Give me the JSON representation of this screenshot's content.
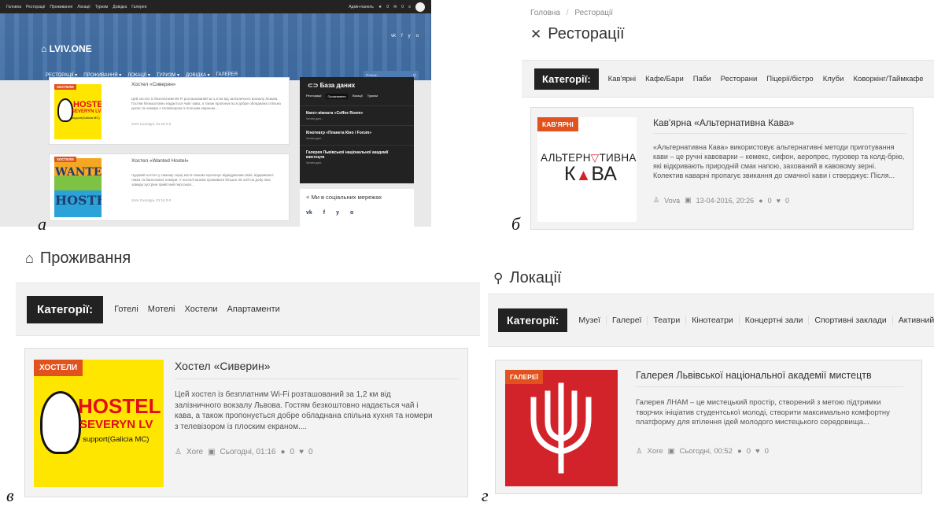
{
  "figure_labels": {
    "a": "а",
    "b": "б",
    "c": "в",
    "d": "г"
  },
  "panel_a": {
    "topbar_links": [
      "Головна",
      "Ресторації",
      "Проживання",
      "Локації",
      "Туризм",
      "Довідка",
      "Галерея"
    ],
    "topbar_right": [
      "Адмін-панель",
      "0",
      "0"
    ],
    "logo": "LVIV.ONE",
    "social": [
      "vk",
      "f",
      "y",
      "o"
    ],
    "menu": [
      "РЕСТОРАЦІЇ ▾",
      "ПРОЖИВАННЯ ▾",
      "ЛОКАЦІЇ ▾",
      "ТУРИЗМ ▾",
      "ДОВІДКА ▾",
      "ГАЛЕРЕЯ"
    ],
    "search_placeholder": "Пошук...",
    "cards": [
      {
        "badge": "ХОСТЕЛИ",
        "title": "Хостел «Сиверин»",
        "text": "Цей хостел із безплатним Wi-Fi розташований за 1,2 км від залізничного вокзалу Львова. Гостям безкоштовно надається чай і кава, а також пропонується добре обладнана спільна кухня та номери з телевізором із плоским екраном....",
        "meta": "Xore   Сьогодні, 01:16   0   0",
        "img_text_1": "HOSTEL",
        "img_text_2": "SEVERYN LV",
        "img_text_3": "support(Galicia MC)"
      },
      {
        "badge": "ХОСТЕЛИ",
        "title": "Хостел «Wanted Hostel»",
        "text": "Чудовий хостел у самому серці міста Львова пропонує відвідувачам свіжі, відкриваючі ліжка та багатомісні номери. У хостелі можна проживати більше 30 осіб на добу. Вас завжди зустріне привітний персонал...",
        "meta": "Xore   Сьогодні, 01:14   0   0",
        "img_text_1": "WANTED",
        "img_text_2": "HOSTEL"
      }
    ],
    "database": {
      "title": "База даних",
      "tabs": [
        "Ресторації",
        "Проживання",
        "Локації",
        "Туризм"
      ],
      "items": [
        {
          "title": "Квест-кімната «Coffee Room»",
          "more": "Читати далі..."
        },
        {
          "title": "Кінотеатр «Планета Кіно / Forum»",
          "more": "Читати далі..."
        },
        {
          "title": "Галерея Львівської національної академії мистецтв",
          "more": "Читати далі..."
        }
      ]
    },
    "social_title": "Ми в соціальних мережах",
    "social_icons": [
      "vk",
      "f",
      "y",
      "o"
    ]
  },
  "panel_b": {
    "breadcrumb": [
      "Головна",
      "/",
      "Ресторації"
    ],
    "title": "Ресторації",
    "cat_label": "Категорії:",
    "categories": [
      "Кав'ярні",
      "Кафе/Бари",
      "Паби",
      "Ресторани",
      "Піцерії/бістро",
      "Клуби",
      "Коворкінг/Таймкафе"
    ],
    "post": {
      "badge": "КАВ'ЯРНІ",
      "title": "Кав'ярна «Альтернативна Кава»",
      "text": "«Альтернативна Кава» використовує альтернативні методи приготування кави – це ручні кавоварки – кемекс, сифон, аеропрес, пуровер та колд-брію, які відкривають природній смак напою, захований в кавовому зерні. Колектив каварні пропагує звикання до смачної кави і стверджує: Після...",
      "author": "Vova",
      "date": "13-04-2016, 20:26",
      "comments": "0",
      "likes": "0",
      "logo_line1": "АЛЬТЕРН",
      "logo_line1b": "ТИВНА",
      "logo_line2": "К",
      "logo_line2b": "ВА"
    }
  },
  "panel_c": {
    "title": "Проживання",
    "cat_label": "Категорії:",
    "categories": [
      "Готелі",
      "Мотелі",
      "Хостели",
      "Апартаменти"
    ],
    "post": {
      "badge": "ХОСТЕЛИ",
      "title": "Хостел «Сиверин»",
      "text": "Цей хостел із безплатним Wi-Fi розташований за 1,2 км від залізничного вокзалу Львова. Гостям безкоштовно надається чай і кава, а також пропонується добре обладнана спільна кухня та номери з телевізором із плоским екраном....",
      "author": "Xore",
      "date": "Сьогодні, 01:16",
      "comments": "0",
      "likes": "0",
      "img_text_1": "HOSTEL",
      "img_text_2": "SEVERYN LV",
      "img_text_3": "support(Galicia MC)"
    }
  },
  "panel_d": {
    "title": "Локації",
    "cat_label": "Категорії:",
    "categories": [
      "Музеї",
      "Галереї",
      "Театри",
      "Кінотеатри",
      "Концертні зали",
      "Спортивні заклади",
      "Активний відпочинок"
    ],
    "post": {
      "badge": "ГАЛЕРЕЇ",
      "title": "Галерея Львівської національної академії мистецтв",
      "text": "Галерея ЛНАМ – це мистецький простір, створений з метою підтримки творчих ініціатив студентської молоді, створити максимально комфортну платформу для втілення ідей молодого мистецького середовища...",
      "author": "Xore",
      "date": "Сьогодні, 00:52",
      "comments": "0",
      "likes": "0"
    }
  },
  "colors": {
    "badge": "#e2521e",
    "catbtn": "#222222",
    "hero": "#3f6ea6",
    "hostel_yellow": "#ffe600",
    "gallery_red": "#d3232a"
  }
}
